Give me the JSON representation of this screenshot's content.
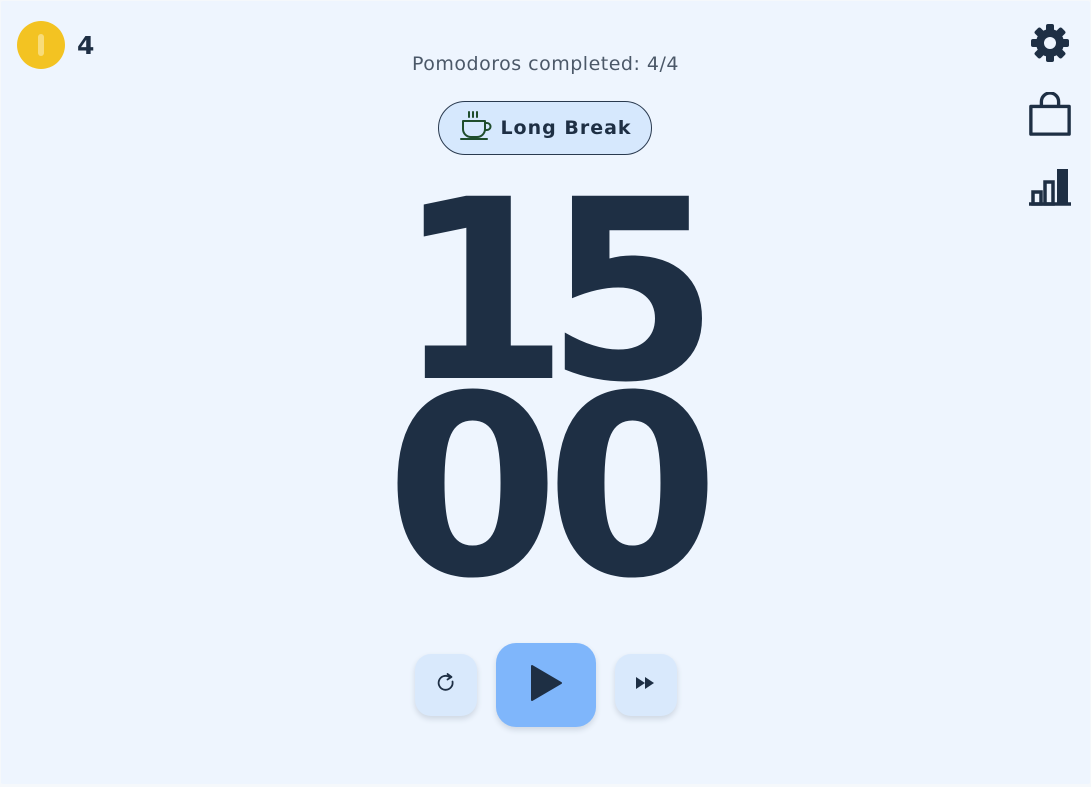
{
  "coins": {
    "count": "4",
    "icon": "coin-icon",
    "color": "#f3c322"
  },
  "status": {
    "text": "Pomodoros completed: 4/4"
  },
  "mode": {
    "label": "Long Break",
    "icon": "coffee-cup-icon"
  },
  "timer": {
    "minutes": "15",
    "seconds": "00"
  },
  "side_menu": [
    {
      "name": "settings",
      "icon": "gear-icon"
    },
    {
      "name": "shop",
      "icon": "shopping-bag-icon"
    },
    {
      "name": "stats",
      "icon": "bar-chart-icon"
    }
  ],
  "controls": {
    "reset_icon": "reset-icon",
    "play_icon": "play-icon",
    "skip_icon": "skip-icon"
  },
  "colors": {
    "background": "#eef5fe",
    "text": "#1e2f44",
    "accent": "#7fb6fb",
    "button": "#d9e9fc",
    "coin": "#f3c322"
  }
}
